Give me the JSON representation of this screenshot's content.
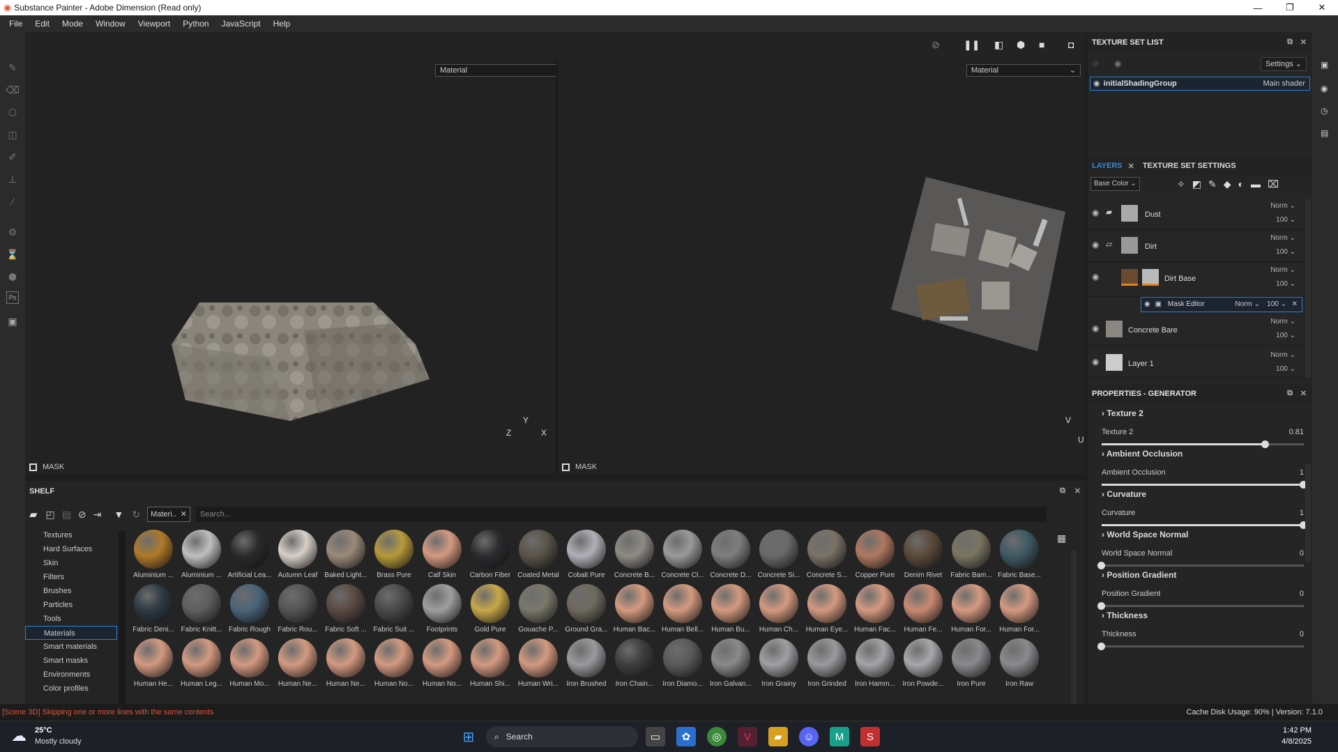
{
  "window": {
    "title": "Substance Painter - Adobe Dimension (Read only)"
  },
  "menu": [
    "File",
    "Edit",
    "Mode",
    "Window",
    "Viewport",
    "Python",
    "JavaScript",
    "Help"
  ],
  "viewports": {
    "left_mode": "Material",
    "right_mode": "Material",
    "mask_label": "MASK",
    "axis_left": [
      "Y",
      "Z",
      "X"
    ],
    "axis_right": [
      "V",
      "U"
    ]
  },
  "shelf": {
    "title": "SHELF",
    "filter_chip": "Materi..",
    "search_placeholder": "Search...",
    "categories": [
      "Textures",
      "Hard Surfaces",
      "Skin",
      "Filters",
      "Brushes",
      "Particles",
      "Tools",
      "Materials",
      "Smart materials",
      "Smart masks",
      "Environments",
      "Color profiles"
    ],
    "active_category": "Materials",
    "rows": [
      [
        "Aluminium ...",
        "Aluminium ...",
        "Artificial Lea...",
        "Autumn Leaf",
        "Baked Light...",
        "Brass Pure",
        "Calf Skin",
        "Carbon Fiber",
        "Coated Metal",
        "Cobalt Pure",
        "Concrete B...",
        "Concrete Cl...",
        "Concrete D...",
        "Concrete Si...",
        "Concrete S...",
        "Copper Pure",
        "Denim Rivet",
        "Fabric Bam...",
        "Fabric Base..."
      ],
      [
        "Fabric Deni...",
        "Fabric Knitt...",
        "Fabric Rough",
        "Fabric Rou...",
        "Fabric Soft ...",
        "Fabric Suit ...",
        "Footprints",
        "Gold Pure",
        "Gouache P...",
        "Ground Gra...",
        "Human Bac...",
        "Human Bell...",
        "Human Bu...",
        "Human Ch...",
        "Human Eye...",
        "Human Fac...",
        "Human Fe...",
        "Human For...",
        "Human For..."
      ],
      [
        "Human He...",
        "Human Leg...",
        "Human Mo...",
        "Human Ne...",
        "Human Ne...",
        "Human No...",
        "Human No...",
        "Human Shi...",
        "Human Wri...",
        "Iron Brushed",
        "Iron Chain...",
        "Iron Diamo...",
        "Iron Galvan...",
        "Iron Grainy",
        "Iron Grinded",
        "Iron Hamm...",
        "Iron Powde...",
        "Iron Pure",
        "Iron Raw"
      ]
    ],
    "row_colors": [
      [
        "#b07a2a",
        "#bfbfbf",
        "#2a2a2a",
        "#d8d0c8",
        "#9a8a78",
        "#b89a3a",
        "#d49a80",
        "#2c2c30",
        "#5a5448",
        "#b0b0b8",
        "#8e8a84",
        "#9a9a9a",
        "#7e7e7e",
        "#6a6a6a",
        "#7a7266",
        "#b07860",
        "#5a4a3a",
        "#7a7460",
        "#3e5a64"
      ],
      [
        "#2e3a44",
        "#5e5e5e",
        "#4a6478",
        "#555",
        "#5a4a44",
        "#4a4a4a",
        "#9e9e9e",
        "#c8a848",
        "#7a786a",
        "#6e6a5e",
        "#d49a80",
        "#d49a80",
        "#d49a80",
        "#d49a80",
        "#d49a80",
        "#d49a80",
        "#c88a70",
        "#d49a80",
        "#d49a80"
      ],
      [
        "#d49a80",
        "#d49a80",
        "#d49a80",
        "#d49a80",
        "#d49a80",
        "#d49a80",
        "#d49a80",
        "#d49a80",
        "#d49a80",
        "#9a9a9e",
        "#3e3e40",
        "#5a5a5a",
        "#8a8a8a",
        "#a0a0a4",
        "#9a9a9e",
        "#a4a4a8",
        "#a8a8ac",
        "#8a8a8e",
        "#8a8a8e"
      ]
    ]
  },
  "texture_set": {
    "title": "TEXTURE SET LIST",
    "settings_label": "Settings",
    "item_name": "initialShadingGroup",
    "item_shader": "Main shader"
  },
  "layers": {
    "tab_layers": "LAYERS",
    "tab_tss": "TEXTURE SET SETTINGS",
    "channel": "Base Color",
    "items": [
      {
        "name": "Dust",
        "blend": "Norm",
        "opacity": "100"
      },
      {
        "name": "Dirt",
        "blend": "Norm",
        "opacity": "100"
      },
      {
        "name": "Dirt Base",
        "blend": "Norm",
        "opacity": "100"
      },
      {
        "name": "Concrete Bare",
        "blend": "Norm",
        "opacity": "100"
      },
      {
        "name": "Layer 1",
        "blend": "Norm",
        "opacity": "100"
      }
    ],
    "mask": {
      "name": "Mask Editor",
      "blend": "Norm",
      "opacity": "100"
    }
  },
  "properties": {
    "title": "PROPERTIES - GENERATOR",
    "groups": [
      {
        "header": "Texture 2",
        "label": "Texture 2",
        "value": "0.81",
        "fraction": 0.81
      },
      {
        "header": "Ambient Occlusion",
        "label": "Ambient Occlusion",
        "value": "1",
        "fraction": 1
      },
      {
        "header": "Curvature",
        "label": "Curvature",
        "value": "1",
        "fraction": 1
      },
      {
        "header": "World Space Normal",
        "label": "World Space Normal",
        "value": "0",
        "fraction": 0
      },
      {
        "header": "Position Gradient",
        "label": "Position Gradient",
        "value": "0",
        "fraction": 0
      },
      {
        "header": "Thickness",
        "label": "Thickness",
        "value": "0",
        "fraction": 0
      }
    ]
  },
  "status": {
    "message": "[Scene 3D] Skipping one or more lines with the same contents",
    "cache": "Cache Disk Usage:   90% | Version: 7.1.0"
  },
  "taskbar": {
    "temp": "25°C",
    "weather": "Mostly cloudy",
    "search": "Search",
    "time": "1:42 PM",
    "date": "4/8/2025"
  },
  "colors": {
    "accent": "#2d7fd6",
    "status_error": "#e0533a",
    "orange": "#e0821e"
  }
}
